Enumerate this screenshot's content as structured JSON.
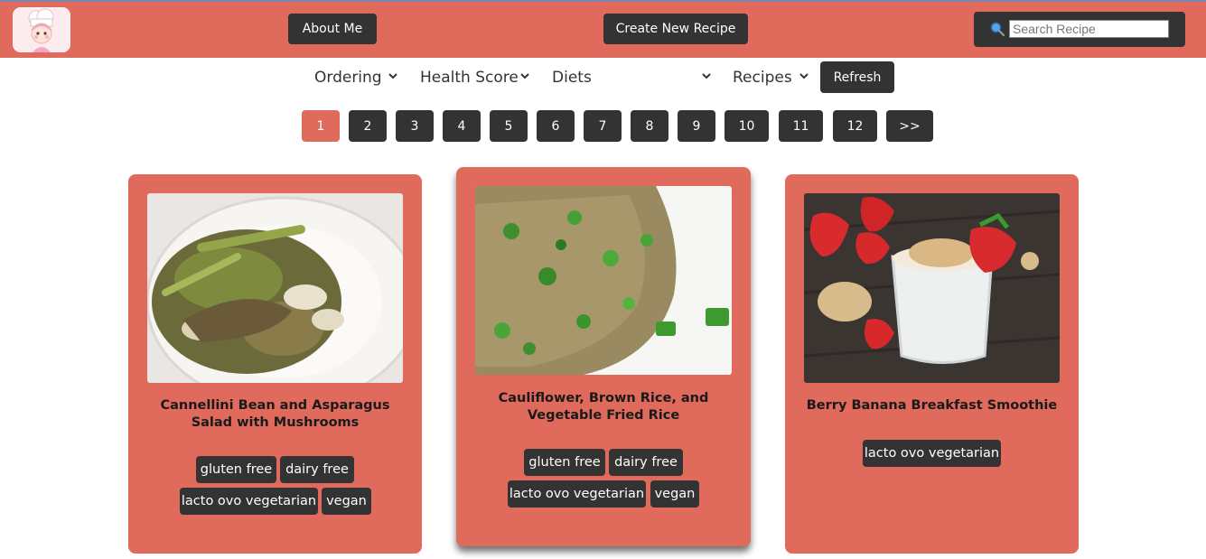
{
  "header": {
    "about_label": "About Me",
    "create_label": "Create New Recipe",
    "search_placeholder": "Search Recipe"
  },
  "filters": {
    "ordering": "Ordering",
    "health_score": "Health Score",
    "diets": "Diets",
    "recipes": "Recipes",
    "refresh": "Refresh"
  },
  "pagination": {
    "pages": [
      "1",
      "2",
      "3",
      "4",
      "5",
      "6",
      "7",
      "8",
      "9",
      "10",
      "11",
      "12",
      ">>"
    ],
    "current": "1"
  },
  "cards": [
    {
      "title": "Cannellini Bean and Asparagus Salad with Mushrooms",
      "tags": [
        "gluten free",
        "dairy free",
        "lacto ovo vegetarian",
        "vegan"
      ]
    },
    {
      "title": "Cauliflower, Brown Rice, and Vegetable Fried Rice",
      "tags": [
        "gluten free",
        "dairy free",
        "lacto ovo vegetarian",
        "vegan"
      ]
    },
    {
      "title": "Berry Banana Breakfast Smoothie",
      "tags": [
        "lacto ovo vegetarian"
      ]
    }
  ],
  "colors": {
    "accent": "#e06a5c",
    "dark": "#333333",
    "background": "#ffffff"
  },
  "icons": {
    "search": "search-icon",
    "logo": "chef-logo-icon",
    "dropdown": "chevron-down-icon"
  }
}
